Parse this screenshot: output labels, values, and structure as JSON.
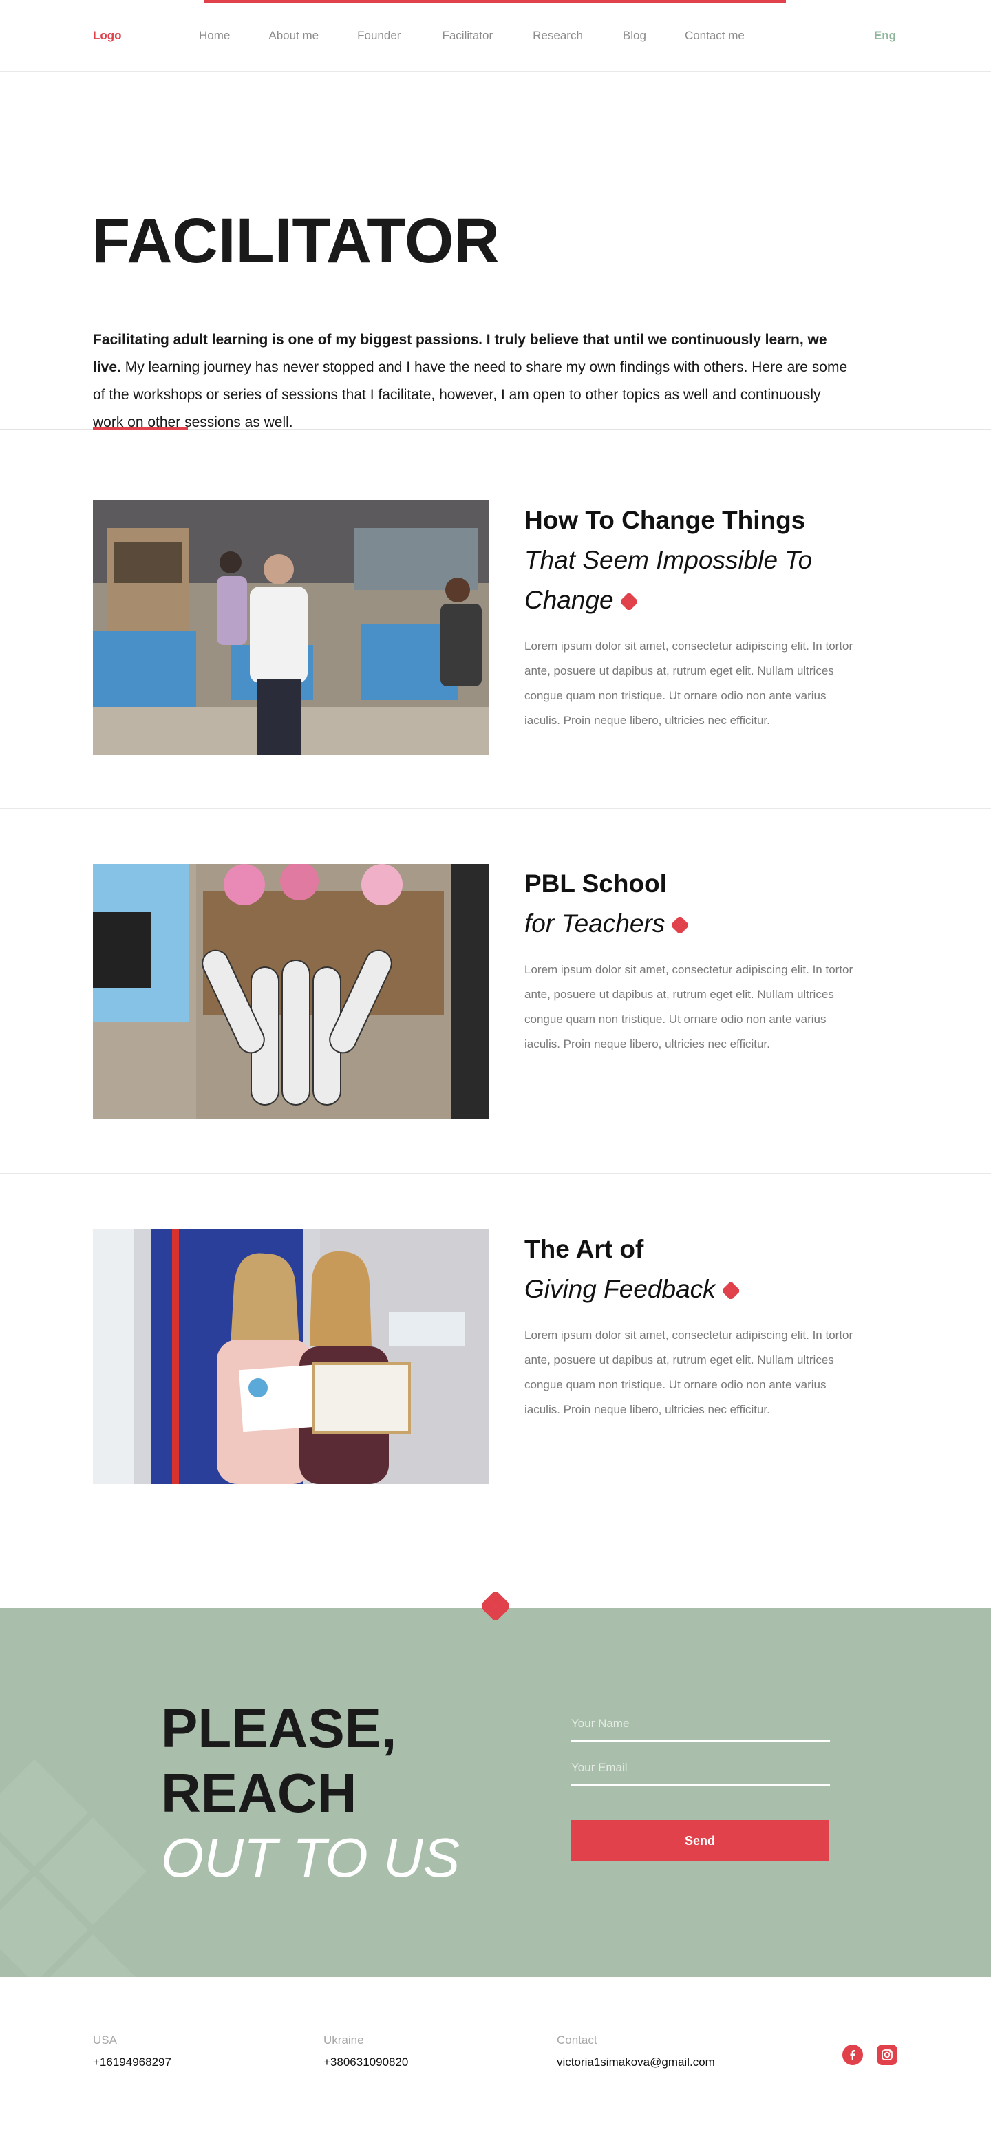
{
  "header": {
    "logo": "Logo",
    "nav": [
      "Home",
      "About me",
      "Founder",
      "Facilitator",
      "Research",
      "Blog",
      "Contact me"
    ],
    "lang": "Eng"
  },
  "hero": {
    "title": "FACILITATOR",
    "intro_bold": "Facilitating adult learning is one of my biggest passions. I truly believe that until we continuously learn, we live.",
    "intro_rest": " My learning journey has never stopped and I have the need to share my own findings with others. Here are some of the workshops or series of sessions that I facilitate, however, I am open to other topics as well and continuously work on other sessions as well."
  },
  "sessions": [
    {
      "title_bold": "How To Change Things",
      "title_italic": "That Seem Impossible To Change",
      "description": "Lorem ipsum dolor sit amet, consectetur adipiscing elit. In tortor ante, posuere ut dapibus at, rutrum eget elit. Nullam ultrices congue quam non tristique. Ut ornare odio non ante varius iaculis. Proin neque libero, ultricies nec efficitur."
    },
    {
      "title_bold": "PBL School",
      "title_italic": "for Teachers",
      "description": "Lorem ipsum dolor sit amet, consectetur adipiscing elit. In tortor ante, posuere ut dapibus at, rutrum eget elit. Nullam ultrices congue quam non tristique. Ut ornare odio non ante varius iaculis. Proin neque libero, ultricies nec efficitur."
    },
    {
      "title_bold": "The Art of",
      "title_italic": "Giving Feedback",
      "description": "Lorem ipsum dolor sit amet, consectetur adipiscing elit. In tortor ante, posuere ut dapibus at, rutrum eget elit. Nullam ultrices congue quam non tristique. Ut ornare odio non ante varius iaculis. Proin neque libero, ultricies nec efficitur."
    }
  ],
  "contact": {
    "heading_line1": "PLEASE,",
    "heading_line2": "REACH",
    "heading_line3": "OUT TO US",
    "name_placeholder": "Your Name",
    "email_placeholder": "Your Email",
    "send_label": "Send"
  },
  "footer": {
    "usa_label": "USA",
    "usa_phone": "+16194968297",
    "ukraine_label": "Ukraine",
    "ukraine_phone": "+380631090820",
    "contact_label": "Contact",
    "contact_email": "victoria1simakova@gmail.com",
    "social_icons": [
      "facebook-icon",
      "instagram-icon"
    ]
  },
  "colors": {
    "accent": "#e0414b",
    "green_bg": "#a9bfab",
    "lang_green": "#8fb59c"
  }
}
